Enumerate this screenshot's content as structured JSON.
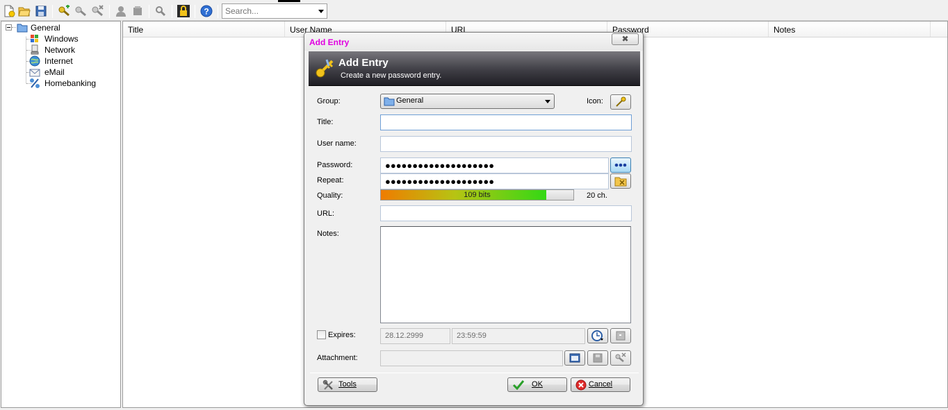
{
  "toolbar": {
    "search_placeholder": "Search...",
    "icons": [
      "new-database-icon",
      "open-database-icon",
      "save-database-icon",
      "add-entry-icon",
      "edit-entry-icon",
      "delete-entry-icon",
      "user-icon",
      "copy-icon",
      "find-icon",
      "lock-icon",
      "help-icon"
    ]
  },
  "tree": {
    "root": "General",
    "items": [
      "Windows",
      "Network",
      "Internet",
      "eMail",
      "Homebanking"
    ]
  },
  "list": {
    "columns": [
      "Title",
      "User Name",
      "URL",
      "Password",
      "Notes"
    ]
  },
  "dialog": {
    "title": "Add Entry",
    "close_label": "✖",
    "banner_title": "Add Entry",
    "banner_subtitle": "Create a new password entry.",
    "group_label": "Group:",
    "group_value": "General",
    "icon_label": "Icon:",
    "title_label": "Title:",
    "title_value": "",
    "username_label": "User name:",
    "username_value": "",
    "password_label": "Password:",
    "password_value": "●●●●●●●●●●●●●●●●●●●●",
    "repeat_label": "Repeat:",
    "repeat_value": "●●●●●●●●●●●●●●●●●●●●",
    "quality_label": "Quality:",
    "quality_text": "109 bits",
    "quality_fraction": 0.86,
    "length_text": "20 ch.",
    "url_label": "URL:",
    "url_value": "",
    "notes_label": "Notes:",
    "notes_value": "",
    "expires_label": "Expires:",
    "expires_date": "28.12.2999",
    "expires_time": "23:59:59",
    "attachment_label": "Attachment:",
    "tools_label": "Tools",
    "ok_label": "OK",
    "cancel_label": "Cancel"
  }
}
